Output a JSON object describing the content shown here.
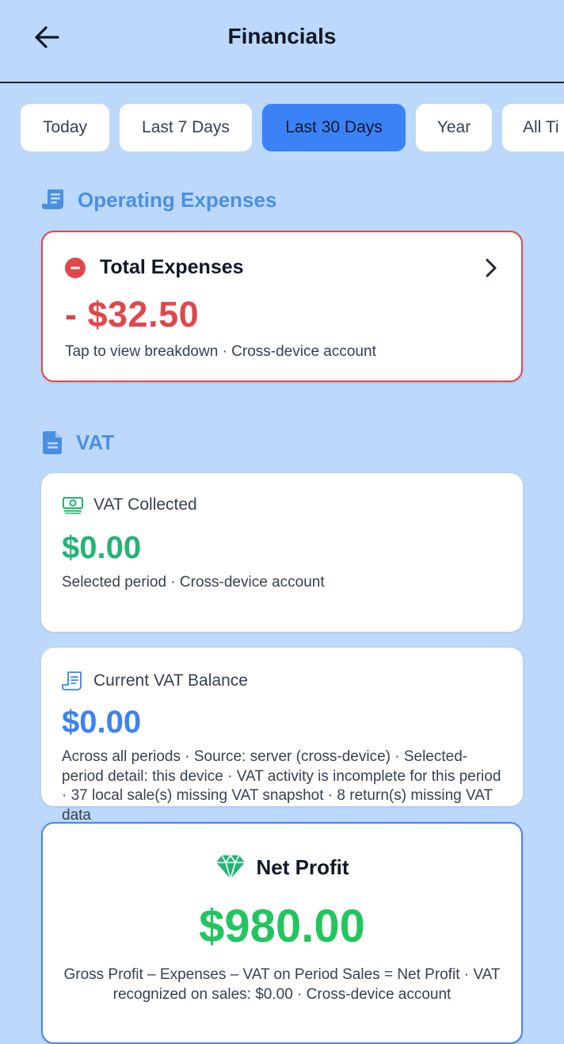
{
  "header": {
    "title": "Financials",
    "back_icon": "arrow-left-icon"
  },
  "tabs": [
    {
      "label": "Today",
      "active": false
    },
    {
      "label": "Last 7 Days",
      "active": false
    },
    {
      "label": "Last 30 Days",
      "active": true
    },
    {
      "label": "Year",
      "active": false
    },
    {
      "label": "All Ti",
      "active": false
    }
  ],
  "operating_expenses": {
    "section_title": "Operating Expenses",
    "icon": "receipt-icon",
    "card": {
      "title": "Total Expenses",
      "amount": "- $32.50",
      "subtitle": "Tap to view breakdown · Cross-device account",
      "status_icon": "minus-circle-icon",
      "chevron_icon": "chevron-right-icon"
    }
  },
  "vat": {
    "section_title": "VAT",
    "icon": "document-icon",
    "collected": {
      "label": "VAT Collected",
      "amount": "$0.00",
      "subtitle": "Selected period · Cross-device account",
      "icon": "banknote-icon"
    },
    "balance": {
      "label": "Current VAT Balance",
      "amount": "$0.00",
      "detail": "Across all periods · Source: server (cross-device) · Selected-period detail: this device · VAT activity is incomplete for this period · 37 local sale(s) missing VAT snapshot · 8 return(s) missing VAT data",
      "icon": "receipt-outline-icon"
    }
  },
  "net_profit": {
    "title": "Net Profit",
    "amount": "$980.00",
    "formula": "Gross Profit – Expenses – VAT on Period Sales = Net Profit · VAT recognized on sales: $0.00 · Cross-device account",
    "icon": "gem-icon"
  },
  "colors": {
    "background": "#bcd8fb",
    "accent": "#3b82f6",
    "expense_red": "#e0474c",
    "success_green": "#22b573",
    "profit_green": "#22c55e",
    "section_blue": "#4a90e2"
  }
}
